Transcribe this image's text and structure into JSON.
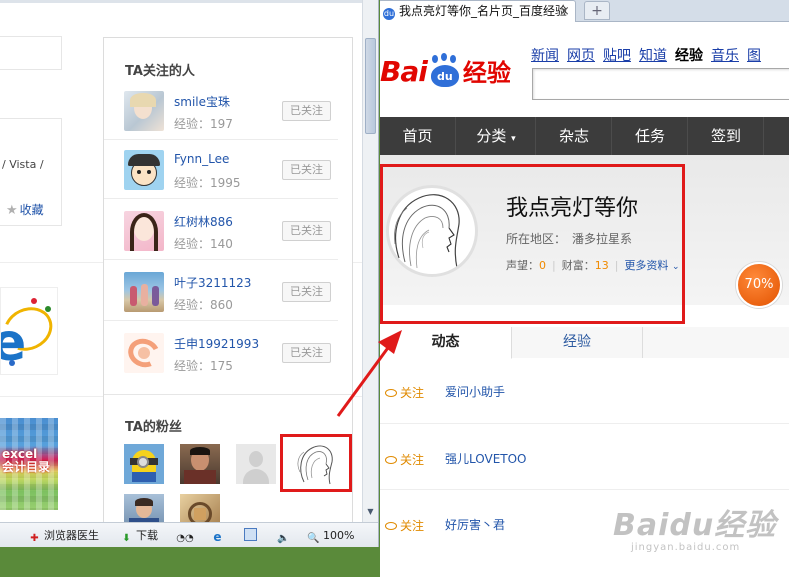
{
  "left_window": {
    "fragment_text": "/ Vista /",
    "collect_label": "收藏",
    "excel_text": "excel\n会计目录",
    "follow_panel": {
      "title": "TA关注的人",
      "users": [
        {
          "name": "smile宝珠",
          "exp": "经验：197",
          "button": "已关注"
        },
        {
          "name": "Fynn_Lee",
          "exp": "经验：1995",
          "button": "已关注"
        },
        {
          "name": "红树林886",
          "exp": "经验：140",
          "button": "已关注"
        },
        {
          "name": "叶子3211123",
          "exp": "经验：860",
          "button": "已关注"
        },
        {
          "name": "壬申19921993",
          "exp": "经验：175",
          "button": "已关注"
        }
      ],
      "fans_title": "TA的粉丝"
    },
    "statusbar": {
      "doctor": "浏览器医生",
      "download": "下载",
      "zoom": "100%"
    }
  },
  "right_window": {
    "tab_title": "我点亮灯等你_名片页_百度经验",
    "tab_close": "×",
    "new_tab": "+",
    "logo": {
      "bai": "Bai",
      "du": "du",
      "jingyan": "经验"
    },
    "top_links": [
      "新闻",
      "网页",
      "贴吧",
      "知道",
      "经验",
      "音乐",
      "图"
    ],
    "top_links_current": "经验",
    "nav": [
      "首页",
      "分类",
      "杂志",
      "任务",
      "签到"
    ],
    "profile": {
      "name": "我点亮灯等你",
      "location_label": "所在地区：",
      "location": "潘多拉星系",
      "reputation_label": "声望：",
      "reputation": "0",
      "wealth_label": "财富：",
      "wealth": "13",
      "more_info": "更多资料",
      "completion": "70%"
    },
    "tabs": [
      "动态",
      "经验"
    ],
    "feed": [
      {
        "tag": "关注",
        "target": "爱问小助手"
      },
      {
        "tag": "关注",
        "target": "强儿LOVETOO"
      },
      {
        "tag": "关注",
        "target": "好厉害丶君"
      }
    ],
    "watermark": "Baidu经验",
    "watermark_sub": "jingyan.baidu.com"
  },
  "colors": {
    "baidu_red": "#e10601",
    "highlight_red": "#e01a1a",
    "link_blue": "#2255aa",
    "orange": "#f08a00",
    "nav_dark": "#3c3c3c"
  },
  "icons": [
    "star-icon",
    "doctor-icon",
    "download-icon",
    "zoom-icon",
    "sound-icon",
    "ie-icon",
    "eye-icon",
    "chevron-down-icon"
  ]
}
